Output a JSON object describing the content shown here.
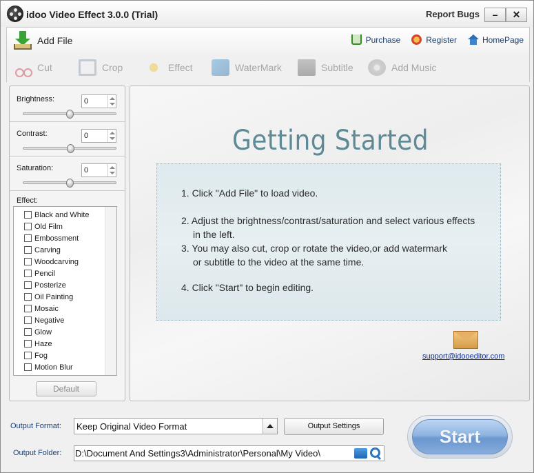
{
  "window": {
    "title": "idoo Video Effect 3.0.0 (Trial)",
    "report_bugs": "Report Bugs",
    "minimize": "–",
    "close": "✕"
  },
  "toolbar": {
    "add_file": "Add File",
    "purchase": "Purchase",
    "register": "Register",
    "homepage": "HomePage"
  },
  "tools": [
    {
      "label": "Cut",
      "icon": "scissors-icon"
    },
    {
      "label": "Crop",
      "icon": "crop-icon"
    },
    {
      "label": "Effect",
      "icon": "effect-star-icon"
    },
    {
      "label": "WaterMark",
      "icon": "watermark-icon"
    },
    {
      "label": "Subtitle",
      "icon": "subtitle-icon"
    },
    {
      "label": "Add Music",
      "icon": "music-disc-icon"
    }
  ],
  "adjustments": {
    "brightness": {
      "label": "Brightness:",
      "value": "0"
    },
    "contrast": {
      "label": "Contrast:",
      "value": "0"
    },
    "saturation": {
      "label": "Saturation:",
      "value": "0"
    }
  },
  "effects": {
    "label": "Effect:",
    "items": [
      "Black and White",
      "Old Film",
      "Embossment",
      "Carving",
      "Woodcarving",
      "Pencil",
      "Posterize",
      "Oil Painting",
      "Mosaic",
      "Negative",
      "Glow",
      "Haze",
      "Fog",
      "Motion Blur"
    ],
    "default_button": "Default"
  },
  "getting_started": {
    "title": "Getting Started",
    "step1": "1. Click \"Add File\" to load video.",
    "step2_line1": "2. Adjust the brightness/contrast/saturation and select various effects",
    "step2_line2": "in the left.",
    "step3_line1": "3. You may also cut, crop or rotate the video,or add watermark",
    "step3_line2": "or subtitle to the video at the same time.",
    "step4": "4. Click \"Start\" to begin editing.",
    "support_email": "support@idooeditor.com"
  },
  "output": {
    "format_label": "Output Format:",
    "format_value": "Keep Original Video Format",
    "settings_button": "Output Settings",
    "folder_label": "Output Folder:",
    "folder_value": "D:\\Document And Settings3\\Administrator\\Personal\\My Video\\",
    "start_button": "Start"
  }
}
